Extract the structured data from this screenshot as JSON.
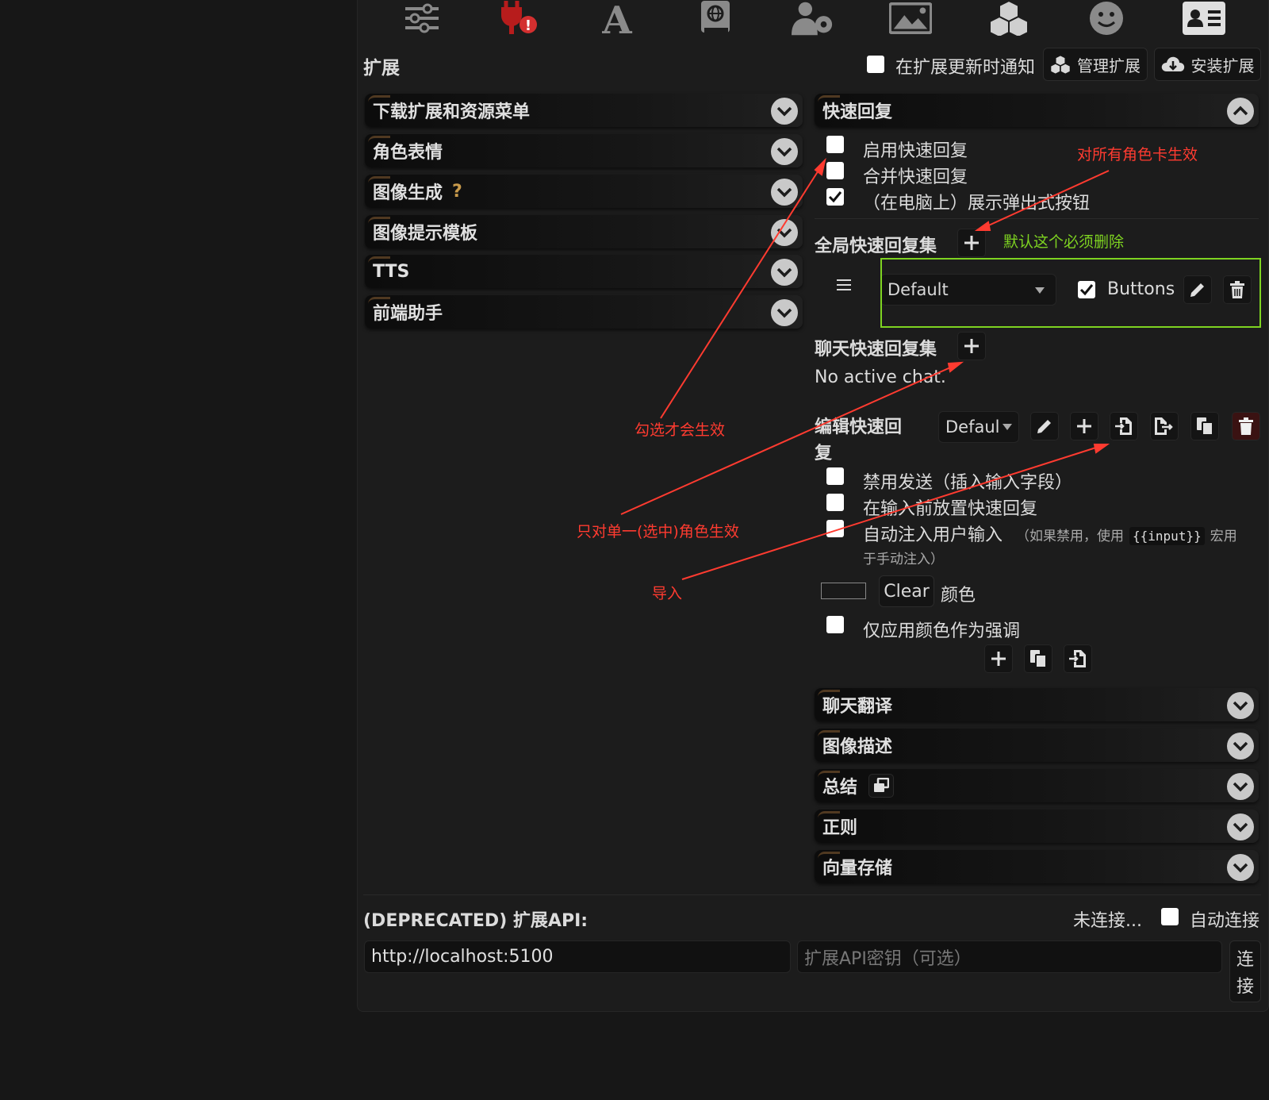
{
  "header": {
    "title": "扩展",
    "notify_label": "在扩展更新时通知",
    "manage_label": "管理扩展",
    "install_label": "安装扩展"
  },
  "top_icons": [
    "sliders-icon",
    "plug-alert-icon",
    "font-icon",
    "book-globe-icon",
    "user-gear-icon",
    "image-icon",
    "cubes-icon",
    "smiley-icon",
    "id-card-icon"
  ],
  "left_drawers": [
    {
      "label": "下载扩展和资源菜单"
    },
    {
      "label": "角色表情"
    },
    {
      "label": "图像生成",
      "help": "?"
    },
    {
      "label": "图像提示模板"
    },
    {
      "label": "TTS"
    },
    {
      "label": "前端助手"
    }
  ],
  "quick_reply": {
    "drawer_title": "快速回复",
    "enable_label": "启用快速回复",
    "combine_label": "合并快速回复",
    "popout_label": "（在电脑上）展示弹出式按钮",
    "global_sets_title": "全局快速回复集",
    "global_set_name": "Default",
    "buttons_label": "Buttons",
    "chat_sets_title": "聊天快速回复集",
    "no_active_chat": "No active chat.",
    "edit_title_line1": "编辑快速回",
    "edit_title_line2": "复",
    "edit_select": "Defaul",
    "disable_send_label": "禁用发送（插入输入字段）",
    "place_before_label": "在输入前放置快速回复",
    "auto_inject_label": "自动注入用户输入",
    "auto_inject_note_pre": "（如果禁用，使用",
    "auto_inject_code": "{{input}}",
    "auto_inject_note_post": "宏用",
    "auto_inject_note_line2": "于手动注入）",
    "clear_label": "Clear",
    "color_label": "颜色",
    "accent_only_label": "仅应用颜色作为强调"
  },
  "right_drawers": [
    {
      "label": "聊天翻译"
    },
    {
      "label": "图像描述"
    },
    {
      "label": "总结"
    },
    {
      "label": "正则"
    },
    {
      "label": "向量存储"
    }
  ],
  "api": {
    "title": "(DEPRECATED) 扩展API:",
    "status": "未连接...",
    "auto_connect_label": "自动连接",
    "url_value": "http://localhost:5100",
    "key_placeholder": "扩展API密钥（可选）",
    "connect_line1": "连",
    "connect_line2": "接"
  },
  "annotations": {
    "all_cards": "对所有角色卡生效",
    "must_delete": "默认这个必须删除",
    "check_to_enable": "勾选才会生效",
    "single_char": "只对单一(选中)角色生效",
    "import": "导入"
  },
  "colors": {
    "annotation_red": "#ff3b30",
    "annotation_green": "#7ed321",
    "delete_red": "#c62828"
  }
}
